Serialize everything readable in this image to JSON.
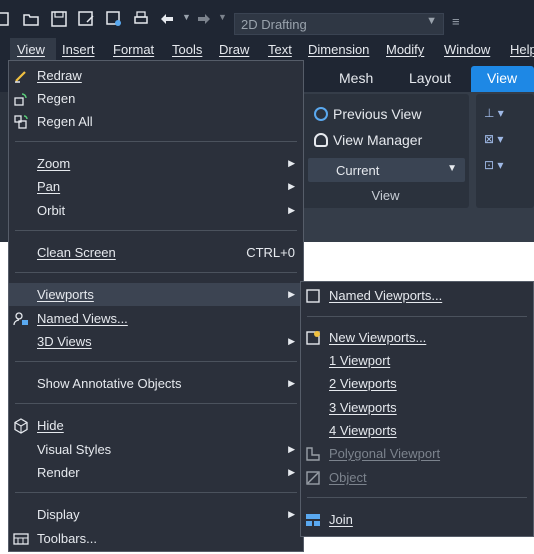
{
  "quick_access": {
    "workspace": "2D Drafting",
    "icons": [
      "app-icon",
      "open-icon",
      "save-icon",
      "save-as-icon",
      "publish-icon",
      "plot-icon",
      "undo-icon",
      "redo-icon"
    ]
  },
  "menubar": {
    "items": [
      "View",
      "Insert",
      "Format",
      "Tools",
      "Draw",
      "Text",
      "Dimension",
      "Modify",
      "Window",
      "Help"
    ]
  },
  "ribbon": {
    "tabs": [
      "Mesh",
      "Layout",
      "View"
    ],
    "view_panel": {
      "previous_view": "Previous View",
      "view_manager": "View Manager",
      "current": "Current",
      "title": "View"
    }
  },
  "view_menu": {
    "items": [
      {
        "label": "Redraw",
        "icon": "redraw-icon"
      },
      {
        "label": "Regen",
        "icon": "regen-icon"
      },
      {
        "label": "Regen All",
        "icon": "regen-all-icon"
      },
      {
        "label": "Zoom"
      },
      {
        "label": "Pan"
      },
      {
        "label": "Orbit"
      },
      {
        "label": "Clean Screen",
        "shortcut": "CTRL+0"
      },
      {
        "label": "Viewports"
      },
      {
        "label": "Named Views...",
        "icon": "named-views-icon"
      },
      {
        "label": "3D Views"
      },
      {
        "label": "Show Annotative Objects"
      },
      {
        "label": "Hide",
        "icon": "hide-icon"
      },
      {
        "label": "Visual Styles"
      },
      {
        "label": "Render"
      },
      {
        "label": "Display"
      },
      {
        "label": "Toolbars...",
        "icon": "toolbars-icon"
      }
    ]
  },
  "viewports_menu": {
    "items": [
      {
        "label": "Named Viewports...",
        "icon": "named-viewports-icon"
      },
      {
        "label": "New Viewports...",
        "icon": "new-viewports-icon"
      },
      {
        "label": "1 Viewport"
      },
      {
        "label": "2 Viewports"
      },
      {
        "label": "3 Viewports"
      },
      {
        "label": "4 Viewports"
      },
      {
        "label": "Polygonal Viewport",
        "icon": "polygonal-viewport-icon"
      },
      {
        "label": "Object",
        "icon": "object-viewport-icon"
      },
      {
        "label": "Join",
        "icon": "join-icon"
      }
    ]
  },
  "colors": {
    "menu_bg": "#2b303b",
    "highlight": "#3c4452",
    "accent": "#1e88e5",
    "disabled": "#7c838d"
  }
}
